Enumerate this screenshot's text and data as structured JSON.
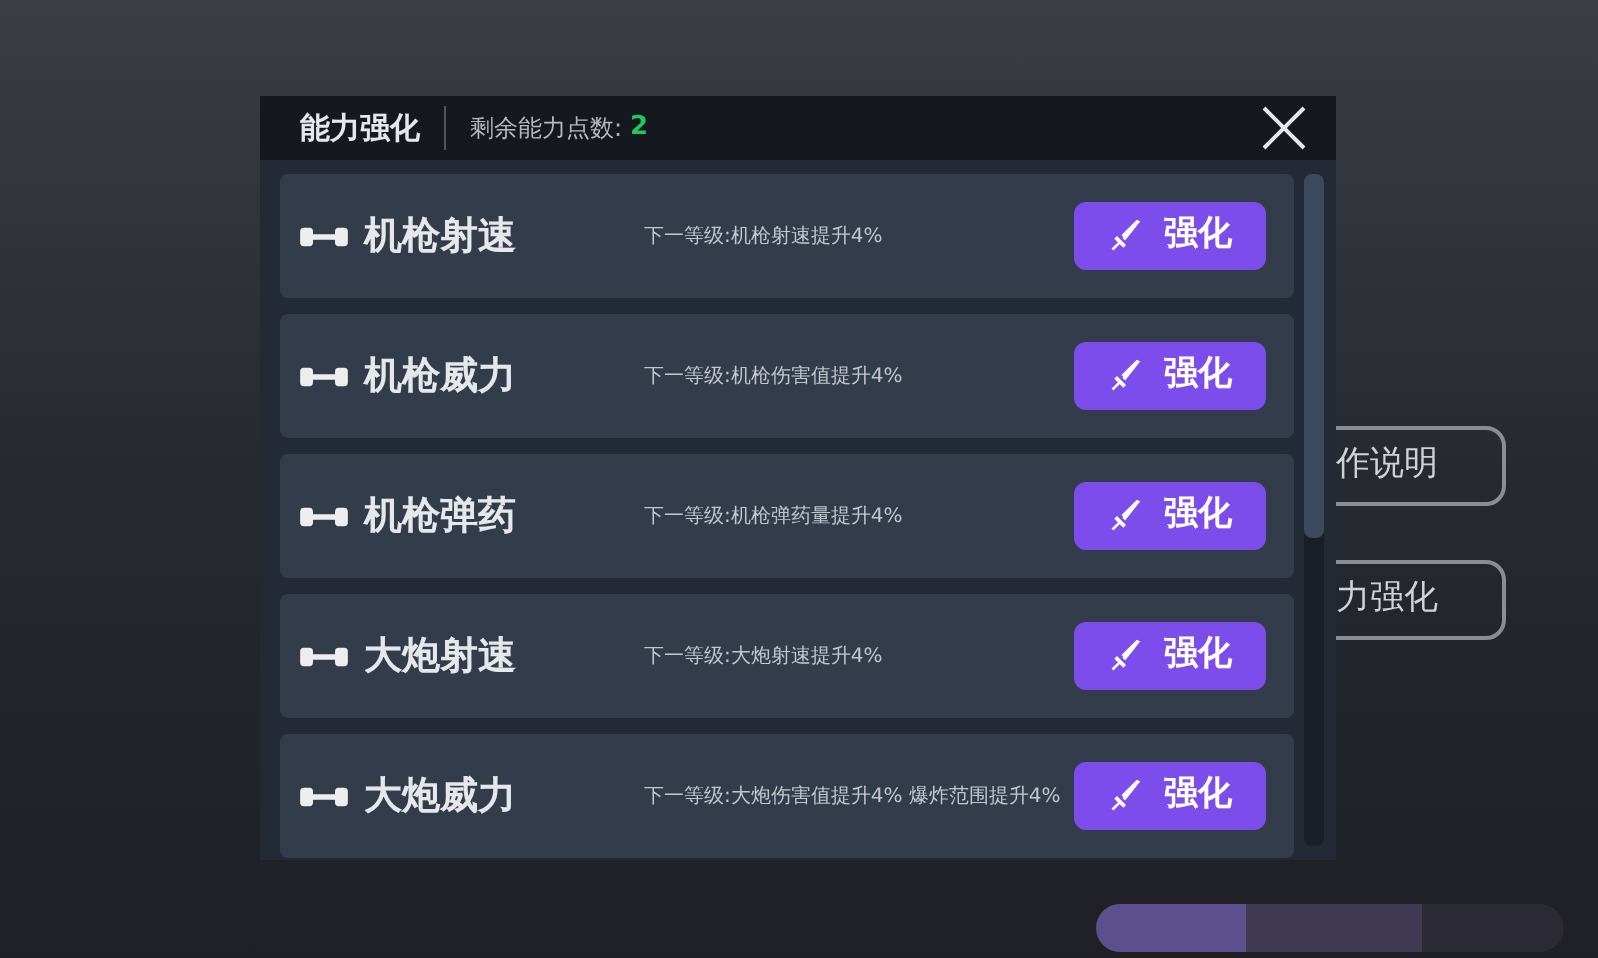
{
  "background_buttons": [
    {
      "label": "作说明"
    },
    {
      "label": "力强化"
    }
  ],
  "dialog": {
    "title": "能力强化",
    "points_label": "剩余能力点数:",
    "points_value": "2",
    "upgrades": [
      {
        "name": "机枪射速",
        "description": "下一等级:机枪射速提升4%",
        "button": "强化"
      },
      {
        "name": "机枪威力",
        "description": "下一等级:机枪伤害值提升4%",
        "button": "强化"
      },
      {
        "name": "机枪弹药",
        "description": "下一等级:机枪弹药量提升4%",
        "button": "强化"
      },
      {
        "name": "大炮射速",
        "description": "下一等级:大炮射速提升4%",
        "button": "强化"
      },
      {
        "name": "大炮威力",
        "description": "下一等级:大炮伤害值提升4% 爆炸范围提升4%",
        "button": "强化"
      }
    ]
  }
}
